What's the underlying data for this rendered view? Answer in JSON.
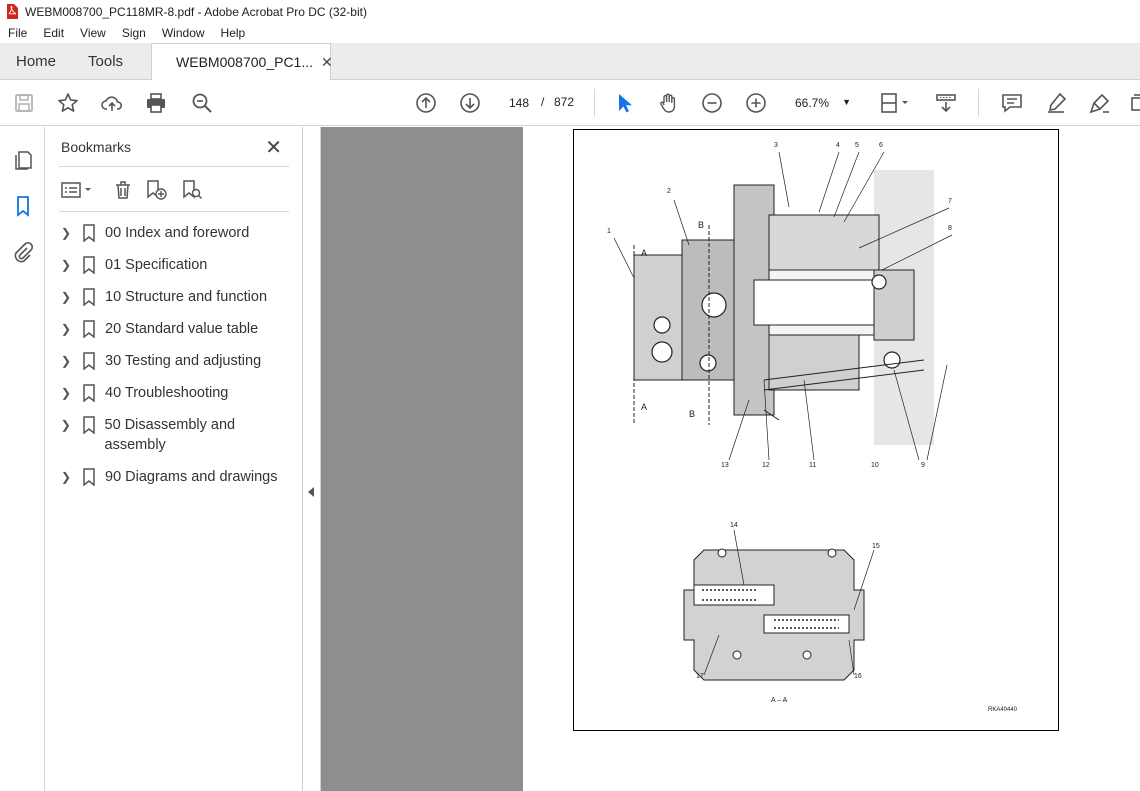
{
  "window": {
    "title": "WEBM008700_PC118MR-8.pdf - Adobe Acrobat Pro DC (32-bit)"
  },
  "menu": [
    "File",
    "Edit",
    "View",
    "Sign",
    "Window",
    "Help"
  ],
  "tabs": {
    "home": "Home",
    "tools": "Tools",
    "document": "WEBM008700_PC1..."
  },
  "toolbar": {
    "page_current": "148",
    "page_separator": "/",
    "page_total": "872",
    "zoom": "66.7%"
  },
  "bookmarks": {
    "title": "Bookmarks",
    "items": [
      {
        "label": "00 Index and foreword"
      },
      {
        "label": "01 Specification"
      },
      {
        "label": "10 Structure and function"
      },
      {
        "label": "20 Standard value table"
      },
      {
        "label": "30 Testing and adjusting"
      },
      {
        "label": "40 Troubleshooting"
      },
      {
        "label": "50 Disassembly and assembly"
      },
      {
        "label": "90 Diagrams and drawings"
      }
    ]
  },
  "drawing": {
    "callouts_top": [
      "1",
      "2",
      "3",
      "4",
      "5",
      "6",
      "7",
      "8",
      "9",
      "10",
      "11",
      "12",
      "13"
    ],
    "callouts_bottom": [
      "14",
      "15",
      "16",
      "17"
    ],
    "section_marks": [
      "A",
      "B",
      "A",
      "B"
    ],
    "section_caption": "A – A",
    "figure_id": "RKA40440"
  },
  "colors": {
    "accent": "#1473e6",
    "doc_bg": "#8e8e8e",
    "pdf_red": "#d4251c"
  }
}
